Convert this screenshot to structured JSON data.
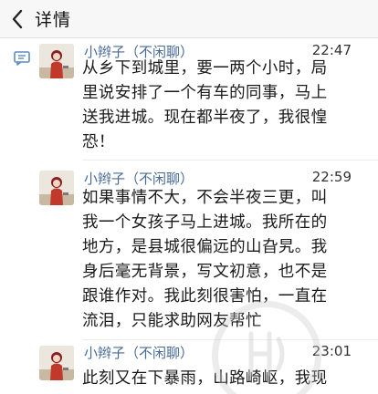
{
  "header": {
    "title": "详情",
    "back_icon": "chevron-left-icon"
  },
  "posts": [
    {
      "author": "小辫子（不闲聊）",
      "time": "22:47",
      "lines": [
        "从乡下到城里，要一两个小时，局",
        "里说安排了一个有车的同事，马上",
        "送我进城。现在都半夜了，我很惶",
        "恐！"
      ]
    },
    {
      "author": "小辫子（不闲聊）",
      "time": "22:59",
      "lines": [
        "如果事情不大，不会半夜三更，叫",
        "我一个女孩子马上进城。我所在的",
        "地方，是县城很偏远的山旮旯。我",
        "身后毫无背景，写文初意，也不是",
        "跟谁作对。我此刻很害怕，一直在",
        "流泪，只能求助网友帮忙"
      ]
    },
    {
      "author": "小辫子（不闲聊）",
      "time": "23:01",
      "lines": [
        "此刻又在下暴雨，山路崎岖，我现"
      ]
    }
  ],
  "colors": {
    "author": "#4a6b96",
    "header_bg": "#f7f7f7",
    "accent_icon": "#5b8cc4"
  }
}
